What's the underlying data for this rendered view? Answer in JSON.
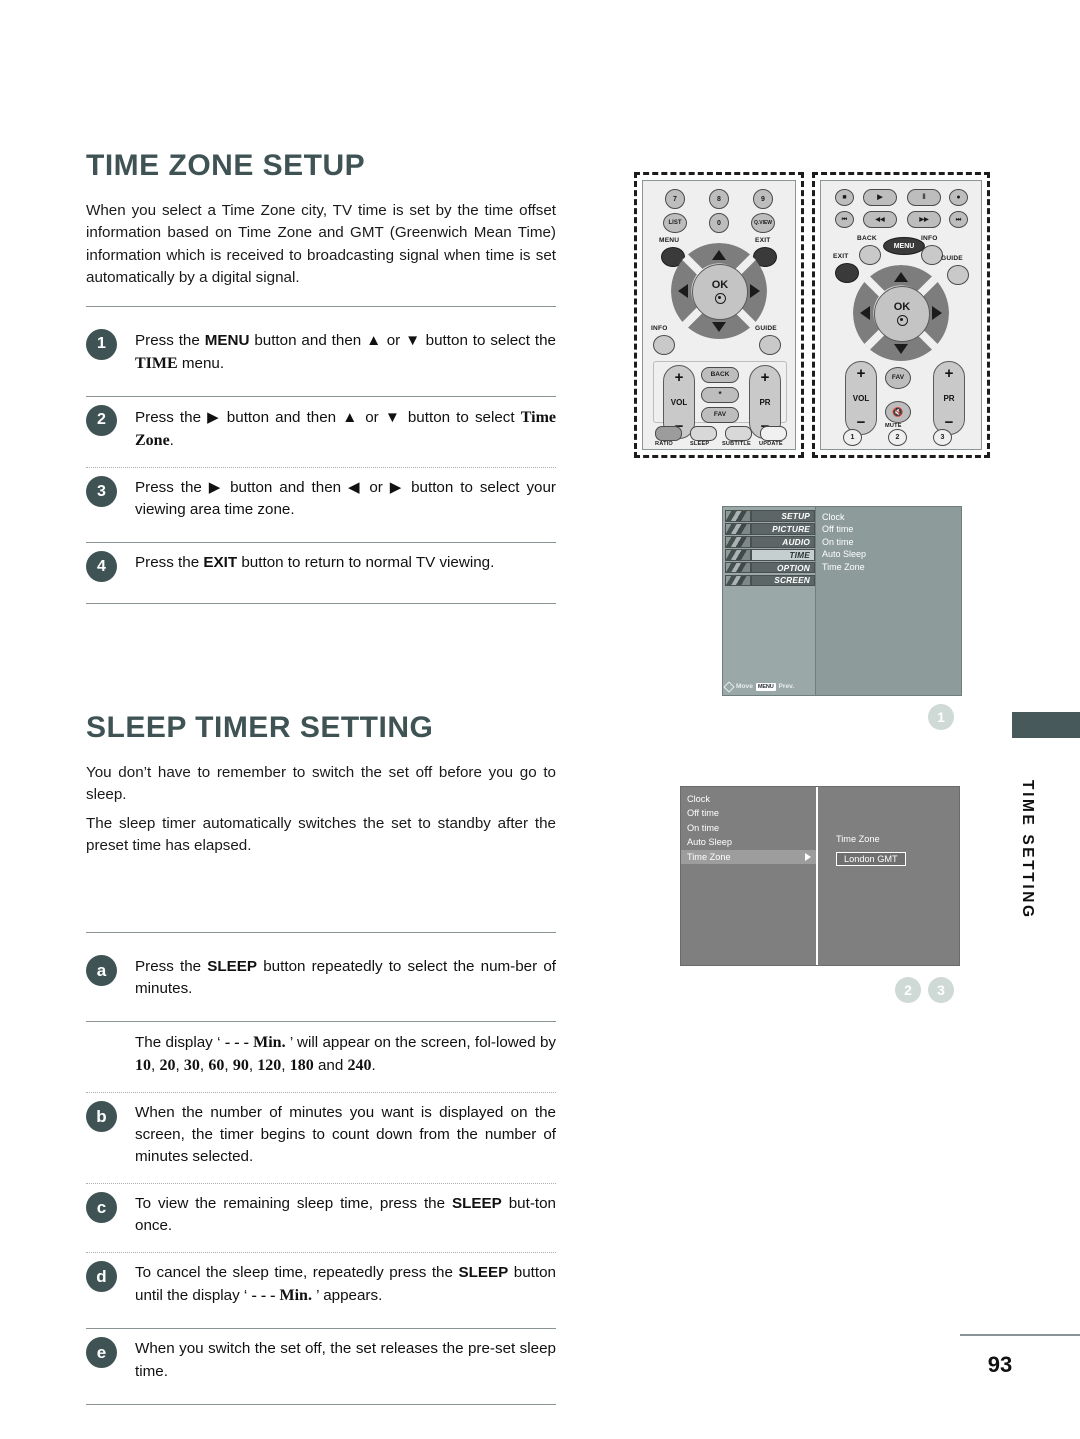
{
  "page": {
    "number": "93",
    "side_tab_label": "TIME SETTING"
  },
  "time_zone_setup": {
    "title": "TIME ZONE SETUP",
    "intro": "When you select a Time Zone city, TV time is set by the time offset information based on Time Zone and GMT (Greenwich Mean Time) information which is received to broadcasting signal when time is set automatically by a digital signal.",
    "steps": [
      {
        "badge": "1",
        "text_html": "Press the <b class=\"k\">MENU</b> button and then ▲ or ▼ button to select the <span class=\"serif-b\">TIME</span> menu."
      },
      {
        "badge": "2",
        "text_html": "Press the ▶ button and then ▲ or ▼ button to select <span class=\"serif-b\">Time Zone</span>."
      },
      {
        "badge": "3",
        "text_html": "Press the ▶ button and then ◀ or ▶ button to select your viewing area time zone."
      },
      {
        "badge": "4",
        "text_html": "Press the <b class=\"k\">EXIT</b> button to return to normal TV viewing."
      }
    ]
  },
  "sleep_timer_setting": {
    "title": "SLEEP TIMER SETTING",
    "intro_1": "You don’t have to remember to switch the set off before you go to sleep.",
    "intro_2": "The sleep timer automatically switches the set to standby after the preset time has elapsed.",
    "steps": [
      {
        "badge": "a",
        "text_html": "Press the <b class=\"k\">SLEEP</b> button repeatedly to select the num-ber of minutes."
      },
      {
        "badge": "",
        "text_html": "The display ‘ <span class=\"serif-b\">- - - Min.</span> ’ will appear on the screen, fol-lowed by <span class=\"serif-b\">10</span>, <span class=\"serif-b\">20</span>, <span class=\"serif-b\">30</span>, <span class=\"serif-b\">60</span>, <span class=\"serif-b\">90</span>, <span class=\"serif-b\">120</span>, <span class=\"serif-b\">180</span> and <span class=\"serif-b\">240</span>."
      },
      {
        "badge": "b",
        "text_html": "When the number of minutes you want is displayed on the screen, the timer begins to count down from the number of minutes selected."
      },
      {
        "badge": "c",
        "text_html": "To view the remaining sleep time, press the <b class=\"k\">SLEEP</b> but-ton once."
      },
      {
        "badge": "d",
        "text_html": "To cancel the sleep time, repeatedly press the <b class=\"k\">SLEEP</b> button until the display ‘ <span class=\"serif-b\">- - - Min.</span> ’ appears."
      },
      {
        "badge": "e",
        "text_html": "When you switch the set off, the set releases the pre-set sleep time."
      }
    ],
    "sleep_options": [
      "10",
      "20",
      "30",
      "60",
      "90",
      "120",
      "180",
      "240"
    ],
    "display_placeholder": "- - - Min."
  },
  "remote_1": {
    "numeric_row_1": [
      "7",
      "8",
      "9"
    ],
    "numeric_row_2": [
      "LIST",
      "0",
      "Q.VIEW"
    ],
    "menu_label": "MENU",
    "exit_label": "EXIT",
    "info_label": "INFO",
    "guide_label": "GUIDE",
    "ok_label": "OK",
    "vol_label": "VOL",
    "pr_label": "PR",
    "back_label": "BACK",
    "star_label": "*",
    "fav_label": "FAV",
    "color_buttons": [
      "RATIO",
      "SLEEP",
      "SUBTITLE",
      "UPDATE"
    ],
    "plus": "+",
    "minus": "−"
  },
  "remote_2": {
    "transport_row_1": [
      "■",
      "▶",
      "‖",
      "●"
    ],
    "transport_row_2": [
      "⏮",
      "◀◀",
      "▶▶",
      "⏭"
    ],
    "back_label": "BACK",
    "menu_label": "MENU",
    "info_label": "INFO",
    "exit_label": "EXIT",
    "guide_label": "GUIDE",
    "ok_label": "OK",
    "vol_label": "VOL",
    "pr_label": "PR",
    "fav_label": "FAV",
    "mute_label": "MUTE",
    "bottom_row": [
      "1",
      "2",
      "3"
    ],
    "plus": "+",
    "minus": "−"
  },
  "osd_menu_1": {
    "nav_items": [
      {
        "label": "SETUP",
        "active": false
      },
      {
        "label": "PICTURE",
        "active": false
      },
      {
        "label": "AUDIO",
        "active": false
      },
      {
        "label": "TIME",
        "active": true
      },
      {
        "label": "OPTION",
        "active": false
      },
      {
        "label": "SCREEN",
        "active": false
      }
    ],
    "items": [
      "Clock",
      "Off time",
      "On time",
      "Auto Sleep",
      "Time Zone"
    ],
    "footer_move": "Move",
    "footer_menu_key": "MENU",
    "footer_prev": "Prev."
  },
  "osd_menu_2": {
    "items": [
      "Clock",
      "Off time",
      "On time",
      "Auto Sleep",
      "Time Zone"
    ],
    "selected_item": "Time Zone",
    "detail_title": "Time Zone",
    "detail_value": "London GMT"
  },
  "callouts": {
    "one": "1",
    "two": "2",
    "three": "3"
  },
  "colors": {
    "heading": "#3f5355",
    "badge": "#3f5355",
    "callout": "#cfd9d6",
    "side_tab": "#47595b",
    "osd_bg": "#9aa8a8",
    "osd2_bg": "#7f7f7f"
  }
}
